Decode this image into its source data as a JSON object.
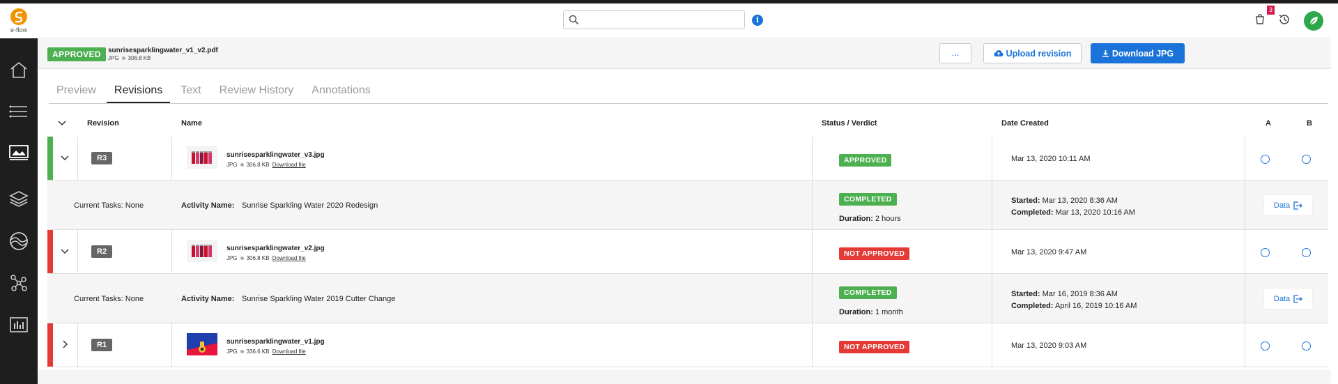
{
  "app": {
    "logo_text": "e-flow"
  },
  "topbar": {
    "search": {
      "placeholder": "",
      "value": ""
    },
    "cart_count": "3"
  },
  "header": {
    "status": "APPROVED",
    "file_name": "sunrisesparklingwater_v1_v2.pdf",
    "file_type": "JPG",
    "file_size": "306.8 KB",
    "more_label": "...",
    "upload_label": "Upload revision",
    "download_label": "Download JPG"
  },
  "tabs": [
    {
      "label": "Preview",
      "active": false
    },
    {
      "label": "Revisions",
      "active": true
    },
    {
      "label": "Text",
      "active": false
    },
    {
      "label": "Review History",
      "active": false
    },
    {
      "label": "Annotations",
      "active": false
    }
  ],
  "table": {
    "headers": {
      "revision": "Revision",
      "name": "Name",
      "status": "Status / Verdict",
      "date": "Date Created",
      "a": "A",
      "b": "B"
    },
    "revisions": [
      {
        "rev": "R3",
        "stripe_color": "#4caf50",
        "expanded": true,
        "file_name": "sunrisesparklingwater_v3.jpg",
        "file_type": "JPG",
        "file_size": "306.8 KB",
        "download_label": "Download file",
        "verdict": "APPROVED",
        "verdict_kind": "approved",
        "date_created": "Mar 13, 2020 10:11 AM",
        "task": {
          "current_tasks": "Current Tasks: None",
          "activity_label": "Activity Name:",
          "activity_name": "Sunrise Sparkling Water 2020 Redesign",
          "status": "COMPLETED",
          "duration_label": "Duration:",
          "duration": "2 hours",
          "started_label": "Started:",
          "started": "Mar 13, 2020 8:36 AM",
          "completed_label": "Completed:",
          "completed": "Mar 13, 2020 10:16 AM",
          "data_label": "Data"
        }
      },
      {
        "rev": "R2",
        "stripe_color": "#e53935",
        "expanded": true,
        "file_name": "sunrisesparklingwater_v2.jpg",
        "file_type": "JPG",
        "file_size": "306.8 KB",
        "download_label": "Download file",
        "verdict": "NOT APPROVED",
        "verdict_kind": "not",
        "date_created": "Mar 13, 2020 9:47 AM",
        "task": {
          "current_tasks": "Current Tasks: None",
          "activity_label": "Activity Name:",
          "activity_name": "Sunrise Sparkling Water 2019 Cutter Change",
          "status": "COMPLETED",
          "duration_label": "Duration:",
          "duration": "1 month",
          "started_label": "Started:",
          "started": "Mar 16, 2019 8:36 AM",
          "completed_label": "Completed:",
          "completed": "April 16, 2019 10:16 AM",
          "data_label": "Data"
        }
      },
      {
        "rev": "R1",
        "stripe_color": "#e53935",
        "expanded": false,
        "file_name": "sunrisesparklingwater_v1.jpg",
        "file_type": "JPG",
        "file_size": "336.6 KB",
        "download_label": "Download file",
        "verdict": "NOT APPROVED",
        "verdict_kind": "not",
        "date_created": "Mar 13, 2020 9:03 AM"
      }
    ]
  }
}
